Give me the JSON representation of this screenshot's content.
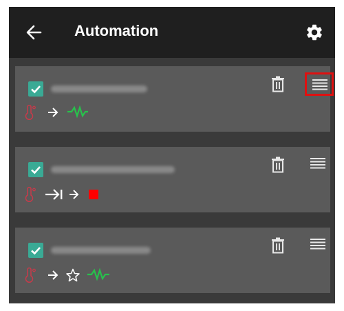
{
  "header": {
    "title": "Automation",
    "back_icon": "arrow-left-icon",
    "settings_icon": "gear-icon"
  },
  "automations": [
    {
      "enabled": true,
      "name_blurred": true,
      "trigger_icon": "temperature-icon",
      "steps": [
        "arrow-right-icon",
        "wave-green-icon"
      ],
      "menu_highlighted": true
    },
    {
      "enabled": true,
      "name_blurred": true,
      "trigger_icon": "temperature-icon",
      "steps": [
        "arrow-right-bar-icon",
        "arrow-right-icon",
        "stop-red-icon"
      ],
      "menu_highlighted": false
    },
    {
      "enabled": true,
      "name_blurred": true,
      "trigger_icon": "temperature-icon",
      "steps": [
        "arrow-right-icon",
        "star-outline-icon",
        "wave-green-icon"
      ],
      "menu_highlighted": false
    }
  ],
  "colors": {
    "header_bg": "#1f1f1f",
    "app_bg": "#3a3a3a",
    "card_bg": "#5a5a5a",
    "checkbox": "#3aaa95",
    "highlight": "#e01010",
    "trigger": "#c83a4a",
    "wave": "#27c24c",
    "stop": "#ff0000"
  }
}
